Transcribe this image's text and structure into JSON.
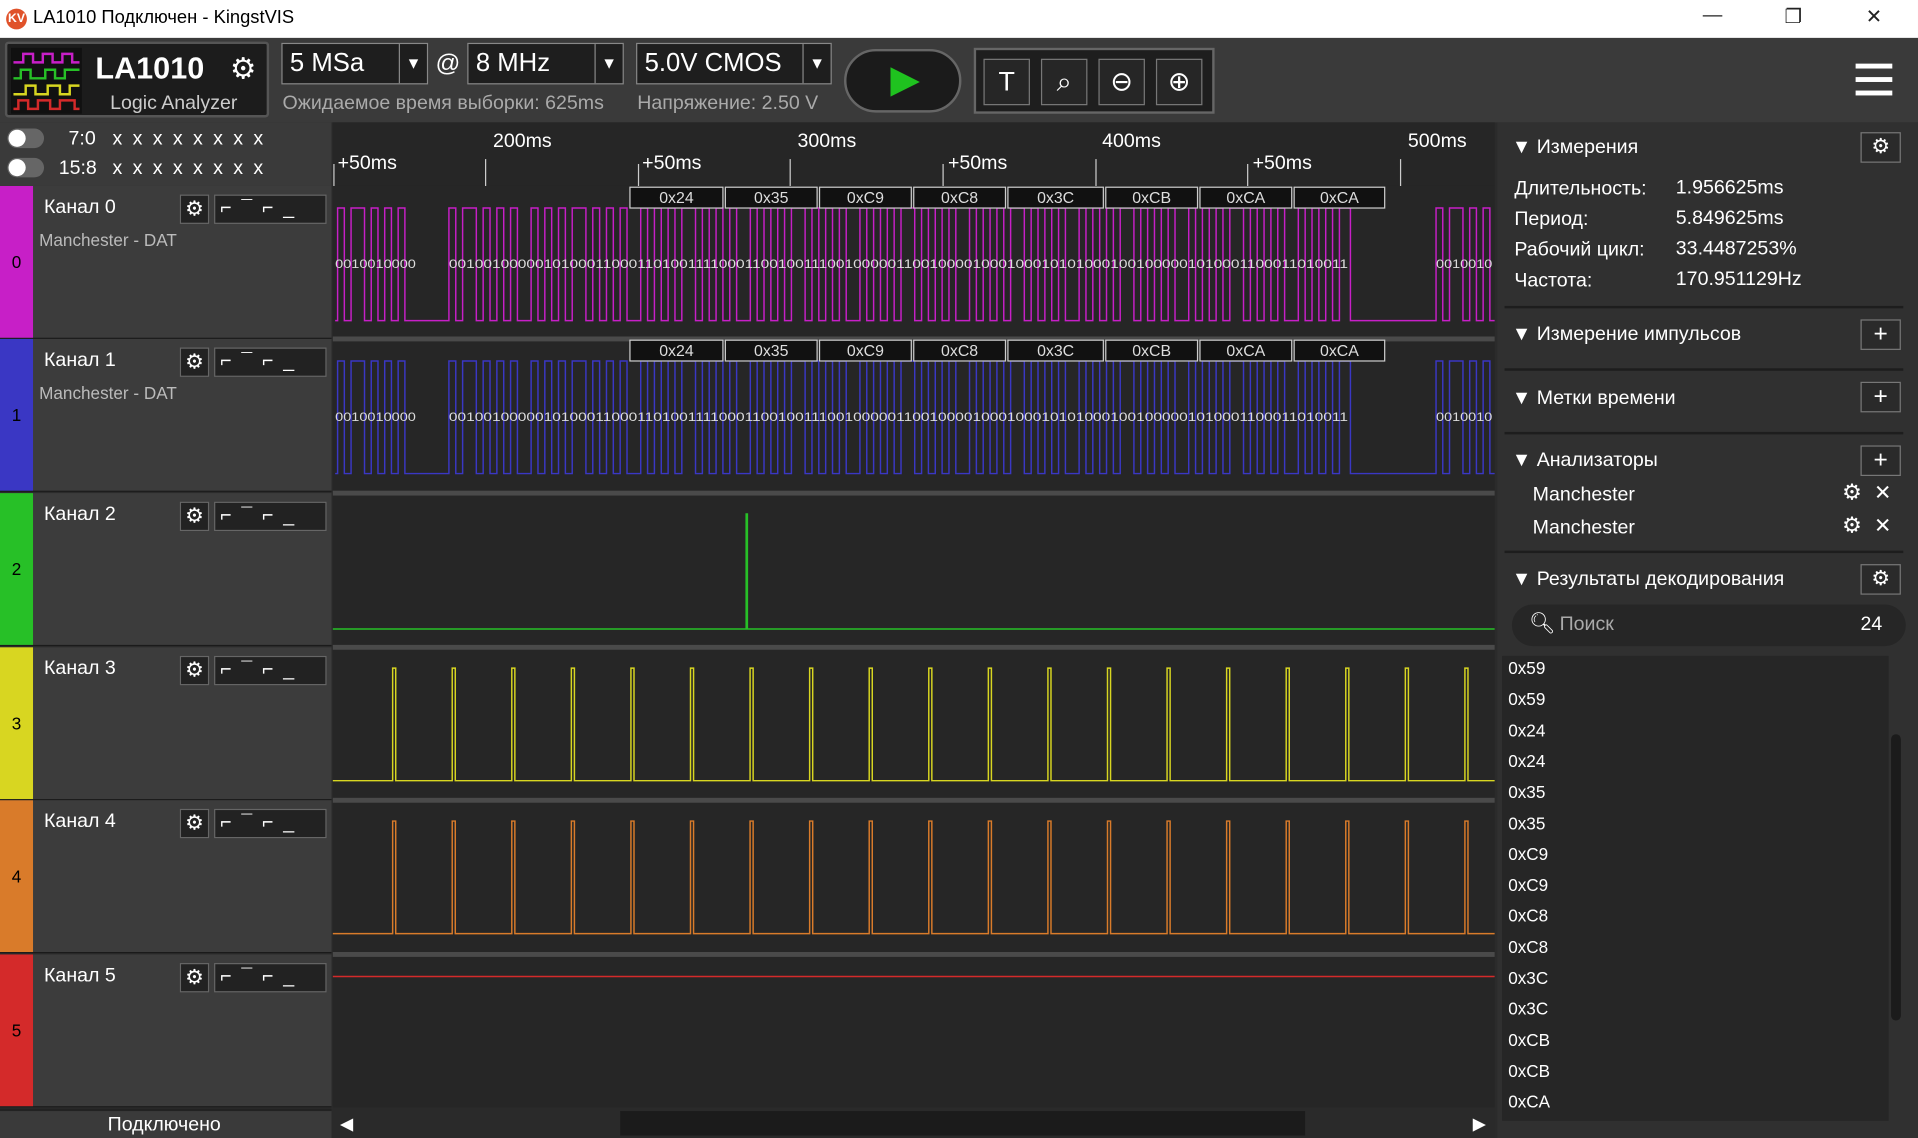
{
  "title": "LA1010 Подключен - KingstVIS",
  "device": {
    "name": "LA1010",
    "subtitle": "Logic Analyzer"
  },
  "sample_rate": "5 MSa",
  "at": "@",
  "sample_freq": "8 MHz",
  "expected_time": "Ожидаемое время выборки: 625ms",
  "voltage_mode": "5.0V CMOS",
  "voltage_text": "Напряжение: 2.50 V",
  "bus_labels": [
    "7:0",
    "15:8"
  ],
  "bus_values": "x x x x x x x x",
  "time_major": [
    "200ms",
    "300ms",
    "400ms",
    "500ms"
  ],
  "time_minor": [
    "+50ms",
    "+50ms",
    "+50ms",
    "+50ms"
  ],
  "channels": [
    {
      "name": "Канал 0",
      "sub": "Manchester - DAT",
      "num": "0",
      "color": "#c71fc7"
    },
    {
      "name": "Канал 1",
      "sub": "Manchester - DAT",
      "num": "1",
      "color": "#3a37c4"
    },
    {
      "name": "Канал 2",
      "sub": "",
      "num": "2",
      "color": "#27c027"
    },
    {
      "name": "Канал 3",
      "sub": "",
      "num": "3",
      "color": "#d8d621"
    },
    {
      "name": "Канал 4",
      "sub": "",
      "num": "4",
      "color": "#d97b2a"
    },
    {
      "name": "Канал 5",
      "sub": "",
      "num": "5",
      "color": "#d42a2a"
    }
  ],
  "decoded_bytes": [
    "0x24",
    "0x35",
    "0xC9",
    "0xC8",
    "0x3C",
    "0xCB",
    "0xCA",
    "0xCA"
  ],
  "bits_text": "0010010000010100011000110100111100011001001110010000011001000010001000101010",
  "status": "Подключено",
  "panel": {
    "measurements": "Измерения",
    "duration_label": "Длительность:",
    "duration": "1.956625ms",
    "period_label": "Период:",
    "period": "5.849625ms",
    "duty_label": "Рабочий цикл:",
    "duty": "33.4487253%",
    "freq_label": "Частота:",
    "freq": "170.951129Hz",
    "pulse": "Измерение импульсов",
    "markers": "Метки времени",
    "analyzers": "Анализаторы",
    "analyzer_items": [
      "Manchester",
      "Manchester"
    ],
    "decode": "Результаты декодирования",
    "search_placeholder": "Поиск",
    "count": "24",
    "results": [
      "0x59",
      "0x59",
      "0x24",
      "0x24",
      "0x35",
      "0x35",
      "0xC9",
      "0xC9",
      "0xC8",
      "0xC8",
      "0x3C",
      "0x3C",
      "0xCB",
      "0xCB",
      "0xCA"
    ]
  }
}
